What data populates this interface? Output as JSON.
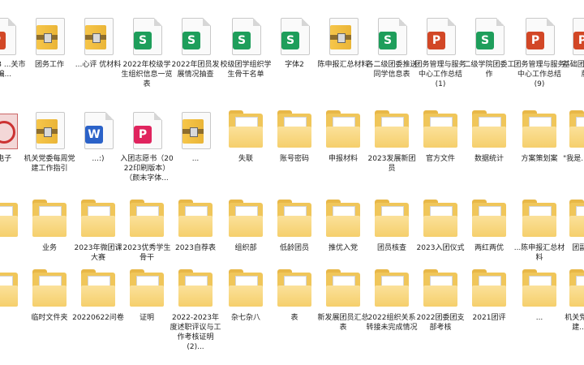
{
  "colors": {
    "excel": "#1e9e5b",
    "ppt": "#d24726",
    "word": "#2b62c8",
    "pdf": "#e0245e",
    "folder": "#f0c65a"
  },
  "items": [
    {
      "name": "item-r1c0",
      "type": "file",
      "badge": "P",
      "color": "#d24726",
      "label": "...2023\n...关市\n...编..."
    },
    {
      "name": "item-r1c1",
      "type": "zip",
      "label": "团务工作"
    },
    {
      "name": "item-r1c2",
      "type": "zip",
      "label": "...心评\n优材料"
    },
    {
      "name": "item-r1c3",
      "type": "file",
      "badge": "S",
      "color": "#1e9e5b",
      "label": "2022年校级学生组织信息一览表"
    },
    {
      "name": "item-r1c4",
      "type": "file",
      "badge": "S",
      "color": "#1e9e5b",
      "label": "2022年团员发展情况抽查"
    },
    {
      "name": "item-r1c5",
      "type": "file",
      "badge": "S",
      "color": "#1e9e5b",
      "label": "校级团学组织学生骨干名单"
    },
    {
      "name": "item-r1c6",
      "type": "file",
      "badge": "S",
      "color": "#1e9e5b",
      "label": "字体2"
    },
    {
      "name": "item-r1c7",
      "type": "zip",
      "label": "陈申报汇总材料"
    },
    {
      "name": "item-r1c8",
      "type": "file",
      "badge": "S",
      "color": "#1e9e5b",
      "label": "各二级团委推送同学信息表"
    },
    {
      "name": "item-r1c9",
      "type": "file",
      "badge": "P",
      "color": "#d24726",
      "label": "团务管理与服务中心工作总结(1)"
    },
    {
      "name": "item-r1c10",
      "type": "file",
      "badge": "S",
      "color": "#1e9e5b",
      "label": "二级学院团委工作"
    },
    {
      "name": "item-r1c11",
      "type": "file",
      "badge": "P",
      "color": "#d24726",
      "label": "团务管理与服务中心工作总结(9)"
    },
    {
      "name": "item-r1c12",
      "type": "file",
      "badge": "P",
      "color": "#d24726",
      "label": "基础团2021...版)"
    },
    {
      "name": "item-r2c0",
      "type": "pic",
      "label": "...电子"
    },
    {
      "name": "item-r2c1",
      "type": "zip",
      "label": "机关党委每周党建工作指引"
    },
    {
      "name": "item-r2c2",
      "type": "file",
      "badge": "W",
      "color": "#2b62c8",
      "label": "...:)"
    },
    {
      "name": "item-r2c3",
      "type": "file",
      "badge": "P",
      "color": "#e0245e",
      "label": "入团志愿书（2022印刷版本）（颜末字体..."
    },
    {
      "name": "item-r2c4",
      "type": "zip",
      "label": "..."
    },
    {
      "name": "item-r2c5",
      "type": "folder",
      "mini": "P",
      "mcolor": "#d24726",
      "label": "失联"
    },
    {
      "name": "item-r2c6",
      "type": "folder",
      "mini": "S",
      "mcolor": "#1e9e5b",
      "label": "账号密码"
    },
    {
      "name": "item-r2c7",
      "type": "folder",
      "mini": "P",
      "mcolor": "#d24726",
      "label": "申报材料"
    },
    {
      "name": "item-r2c8",
      "type": "folder",
      "mini": "S",
      "mcolor": "#1e9e5b",
      "label": "2023发展新团员"
    },
    {
      "name": "item-r2c9",
      "type": "folder",
      "mini": "P",
      "mcolor": "#d24726",
      "label": "官方文件"
    },
    {
      "name": "item-r2c10",
      "type": "folder",
      "mini": "S",
      "mcolor": "#1e9e5b",
      "label": "数据统计"
    },
    {
      "name": "item-r2c11",
      "type": "folder",
      "mini": "W",
      "mcolor": "#2b62c8",
      "label": "方案策划案"
    },
    {
      "name": "item-r2c12",
      "type": "folder",
      "mini": "W",
      "mcolor": "#2b62c8",
      "label": "\"我是...团支书"
    },
    {
      "name": "item-r3c0",
      "type": "folder",
      "mini": "W",
      "mcolor": "#2b62c8",
      "label": ""
    },
    {
      "name": "item-r3c1",
      "type": "folder",
      "mini": "W",
      "mcolor": "#2b62c8",
      "label": "业务"
    },
    {
      "name": "item-r3c2",
      "type": "folder",
      "mini": "S",
      "mcolor": "#1e9e5b",
      "label": "2023年微团课大赛"
    },
    {
      "name": "item-r3c3",
      "type": "folder",
      "mini": "S",
      "mcolor": "#1e9e5b",
      "label": "2023优秀学生骨干"
    },
    {
      "name": "item-r3c4",
      "type": "folder",
      "mini": "P",
      "mcolor": "#d24726",
      "label": "2023自荐表"
    },
    {
      "name": "item-r3c5",
      "type": "folder",
      "mini": "P",
      "mcolor": "#d24726",
      "label": "组织部"
    },
    {
      "name": "item-r3c6",
      "type": "folder",
      "mini": "S",
      "mcolor": "#1e9e5b",
      "label": "低龄团员"
    },
    {
      "name": "item-r3c7",
      "type": "folder",
      "mini": "W",
      "mcolor": "#2b62c8",
      "label": "推优入党"
    },
    {
      "name": "item-r3c8",
      "type": "folder",
      "mini": "P",
      "mcolor": "#d24726",
      "label": "团员核查"
    },
    {
      "name": "item-r3c9",
      "type": "folder",
      "mini": "P",
      "mcolor": "#d24726",
      "label": "2023入团仪式"
    },
    {
      "name": "item-r3c10",
      "type": "folder",
      "mini": "S",
      "mcolor": "#1e9e5b",
      "label": "两红两优"
    },
    {
      "name": "item-r3c11",
      "type": "folder",
      "mini": "W",
      "mcolor": "#2b62c8",
      "label": "...陈申报汇总材料"
    },
    {
      "name": "item-r3c12",
      "type": "folder",
      "mini": "W",
      "mcolor": "#2b62c8",
      "label": "团副...料"
    },
    {
      "name": "item-r4c0",
      "type": "folder",
      "mini": "P",
      "mcolor": "#d24726",
      "label": ""
    },
    {
      "name": "item-r4c1",
      "type": "folder",
      "mini": "W",
      "mcolor": "#2b62c8",
      "label": "临时文件夹"
    },
    {
      "name": "item-r4c2",
      "type": "folder",
      "mini": "S",
      "mcolor": "#1e9e5b",
      "label": "20220622问卷"
    },
    {
      "name": "item-r4c3",
      "type": "folder",
      "mini": "W",
      "mcolor": "#2b62c8",
      "label": "证明"
    },
    {
      "name": "item-r4c4",
      "type": "folder",
      "mini": "P",
      "mcolor": "#d24726",
      "label": "2022-2023年度述职评议与工作考核证明(2)..."
    },
    {
      "name": "item-r4c5",
      "type": "folder",
      "mini": "S",
      "mcolor": "#1e9e5b",
      "label": "杂七杂八"
    },
    {
      "name": "item-r4c6",
      "type": "folder",
      "mini": "S",
      "mcolor": "#1e9e5b",
      "label": "表"
    },
    {
      "name": "item-r4c7",
      "type": "folder",
      "mini": "W",
      "mcolor": "#2b62c8",
      "label": "新发展团员汇总表"
    },
    {
      "name": "item-r4c8",
      "type": "folder",
      "mini": "W",
      "mcolor": "#2b62c8",
      "label": "2022组织关系转接未完成情况"
    },
    {
      "name": "item-r4c9",
      "type": "folder",
      "mini": "W",
      "mcolor": "#2b62c8",
      "label": "2022团委团支部考核"
    },
    {
      "name": "item-r4c10",
      "type": "folder",
      "mini": "W",
      "mcolor": "#2b62c8",
      "label": "2021团评"
    },
    {
      "name": "item-r4c11",
      "type": "folder",
      "mini": "P",
      "mcolor": "#d24726",
      "label": "..."
    },
    {
      "name": "item-r4c12",
      "type": "folder",
      "mini": "W",
      "mcolor": "#2b62c8",
      "label": "机关党...周党建...指引"
    }
  ]
}
